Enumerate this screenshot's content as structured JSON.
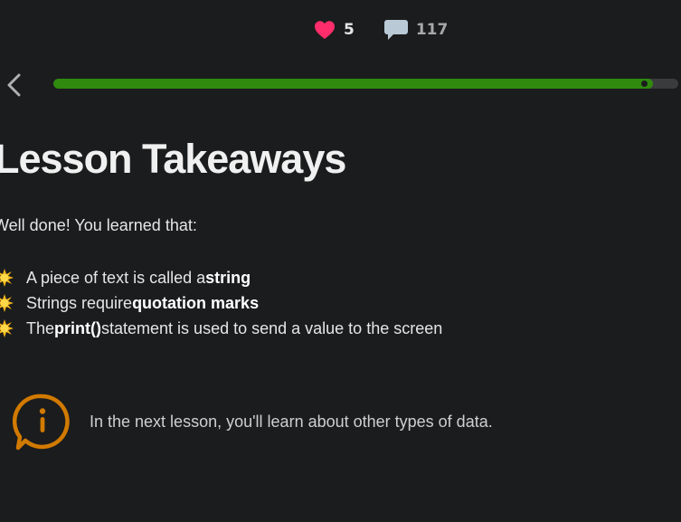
{
  "stats": {
    "hearts": "5",
    "comments": "117"
  },
  "progress": {
    "fraction": 0.96
  },
  "lesson": {
    "title": "Lesson Takeaways",
    "intro": "Well done! You learned that:",
    "takeaways": [
      {
        "before": "A piece of text is called a ",
        "bold": "string",
        "after": ""
      },
      {
        "before": "Strings require ",
        "bold": "quotation marks",
        "after": ""
      },
      {
        "before": "The ",
        "bold": "print()",
        "after": " statement is used to send a value to the screen"
      }
    ],
    "info_note": "In the next lesson, you'll learn about other types of data."
  },
  "colors": {
    "background": "#1b1c1d",
    "progress_fill": "#2f8a0e",
    "heart": "#ff2d6b",
    "info_accent": "#d17a00"
  },
  "icons": {
    "back": "chevron-left-icon",
    "heart": "heart-icon",
    "comment": "comment-icon",
    "bullet": "sun-icon",
    "info": "info-icon"
  }
}
